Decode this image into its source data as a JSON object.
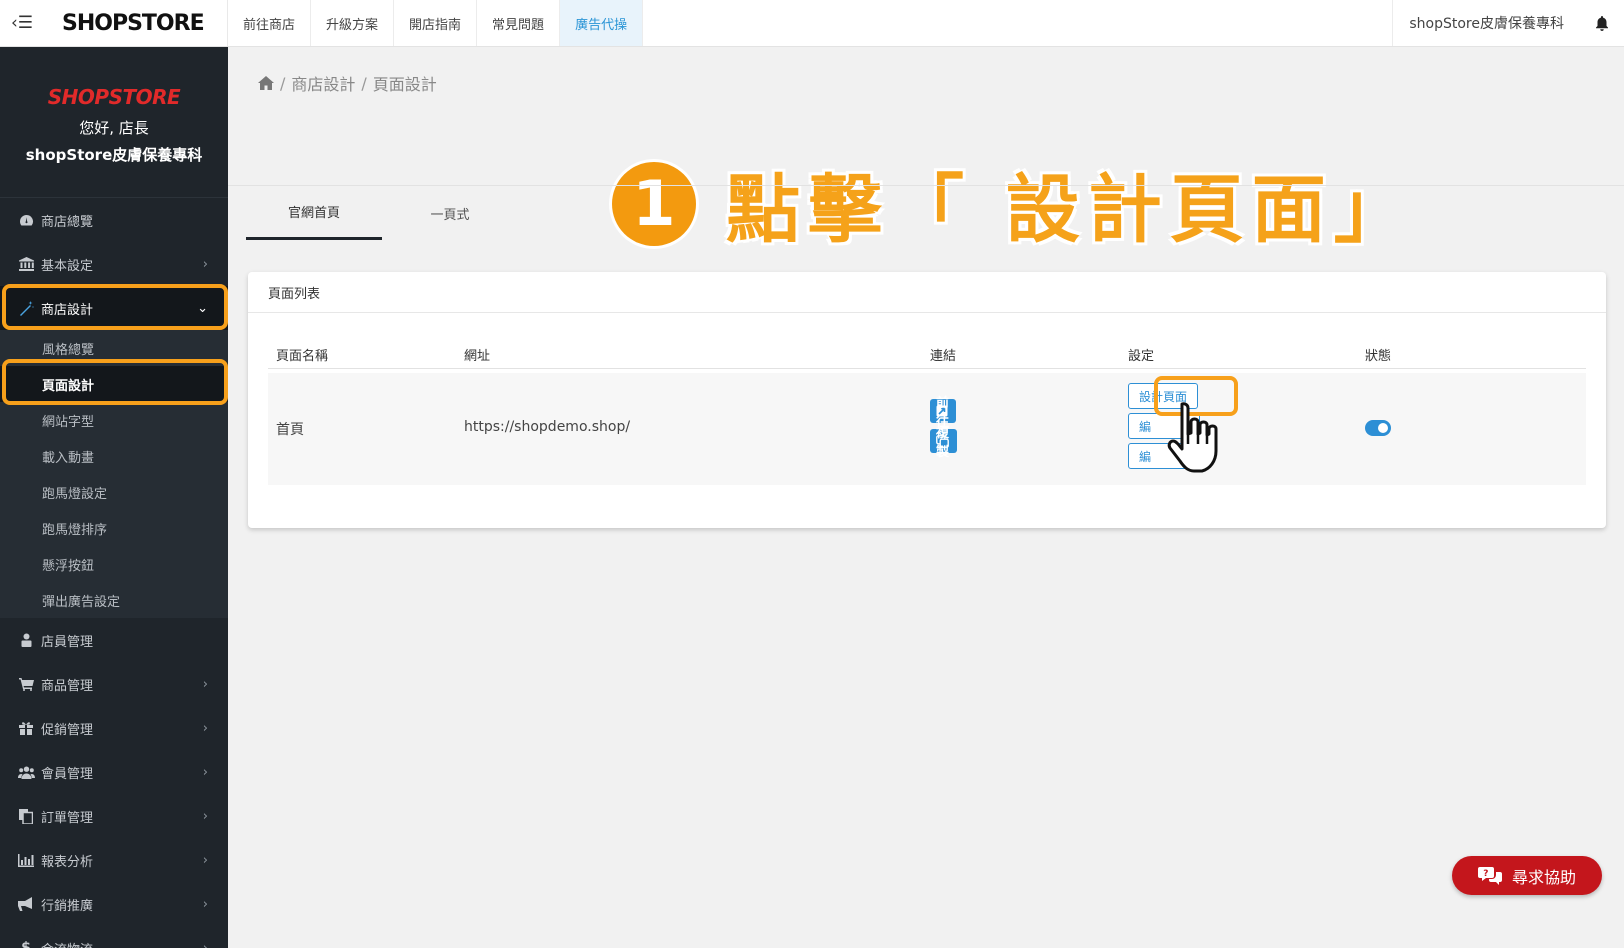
{
  "topbar": {
    "brand": "SHOPSTORE",
    "tabs": [
      {
        "label": "前往商店"
      },
      {
        "label": "升級方案"
      },
      {
        "label": "開店指南"
      },
      {
        "label": "常見問題"
      },
      {
        "label": "廣告代操"
      }
    ],
    "active_tab": "廣告代操",
    "store_name": "shopStore皮膚保養專科"
  },
  "sidebar": {
    "logo": "SHOPSTORE",
    "greeting": "您好, 店長",
    "store_name": "shopStore皮膚保養專科",
    "items": [
      {
        "label": "商店總覽",
        "icon": "dashboard-icon"
      },
      {
        "label": "基本設定",
        "icon": "bank-icon"
      },
      {
        "label": "商店設計",
        "icon": "magic-wand-icon"
      },
      {
        "label": "店員管理",
        "icon": "user-lock-icon"
      },
      {
        "label": "商品管理",
        "icon": "cart-icon"
      },
      {
        "label": "促銷管理",
        "icon": "gift-icon"
      },
      {
        "label": "會員管理",
        "icon": "users-icon"
      },
      {
        "label": "訂單管理",
        "icon": "copy-icon"
      },
      {
        "label": "報表分析",
        "icon": "bar-chart-icon"
      },
      {
        "label": "行銷推廣",
        "icon": "bullhorn-icon"
      },
      {
        "label": "金流物流",
        "icon": "dollar-icon"
      }
    ],
    "subitems": [
      {
        "label": "風格總覽"
      },
      {
        "label": "頁面設計"
      },
      {
        "label": "網站字型"
      },
      {
        "label": "載入動畫"
      },
      {
        "label": "跑馬燈設定"
      },
      {
        "label": "跑馬燈排序"
      },
      {
        "label": "懸浮按鈕"
      },
      {
        "label": "彈出廣告設定"
      }
    ],
    "active_subitem": "頁面設計"
  },
  "breadcrumb": [
    "商店設計",
    "頁面設計"
  ],
  "annotation": {
    "number": "1",
    "text": "點擊「 設計頁面」"
  },
  "tabs": [
    {
      "label": "官網首頁"
    },
    {
      "label": "一頁式"
    }
  ],
  "active_tab": "官網首頁",
  "card": {
    "title": "頁面列表",
    "columns": [
      "頁面名稱",
      "網址",
      "連結",
      "設定",
      "狀態"
    ],
    "rows": [
      {
        "name": "首頁",
        "url": "https://shopdemo.shop/",
        "link_buttons": [
          "前往",
          "複製"
        ],
        "setting_buttons": [
          "設計頁面",
          "編",
          "編"
        ],
        "status_enabled": true
      }
    ]
  },
  "help_button": {
    "label": "尋求協助"
  },
  "colors": {
    "accent_blue": "#2d8fd5",
    "highlight_orange": "#f7a01b",
    "sidebar_bg": "#1f252b",
    "help_red": "#c4161c"
  }
}
